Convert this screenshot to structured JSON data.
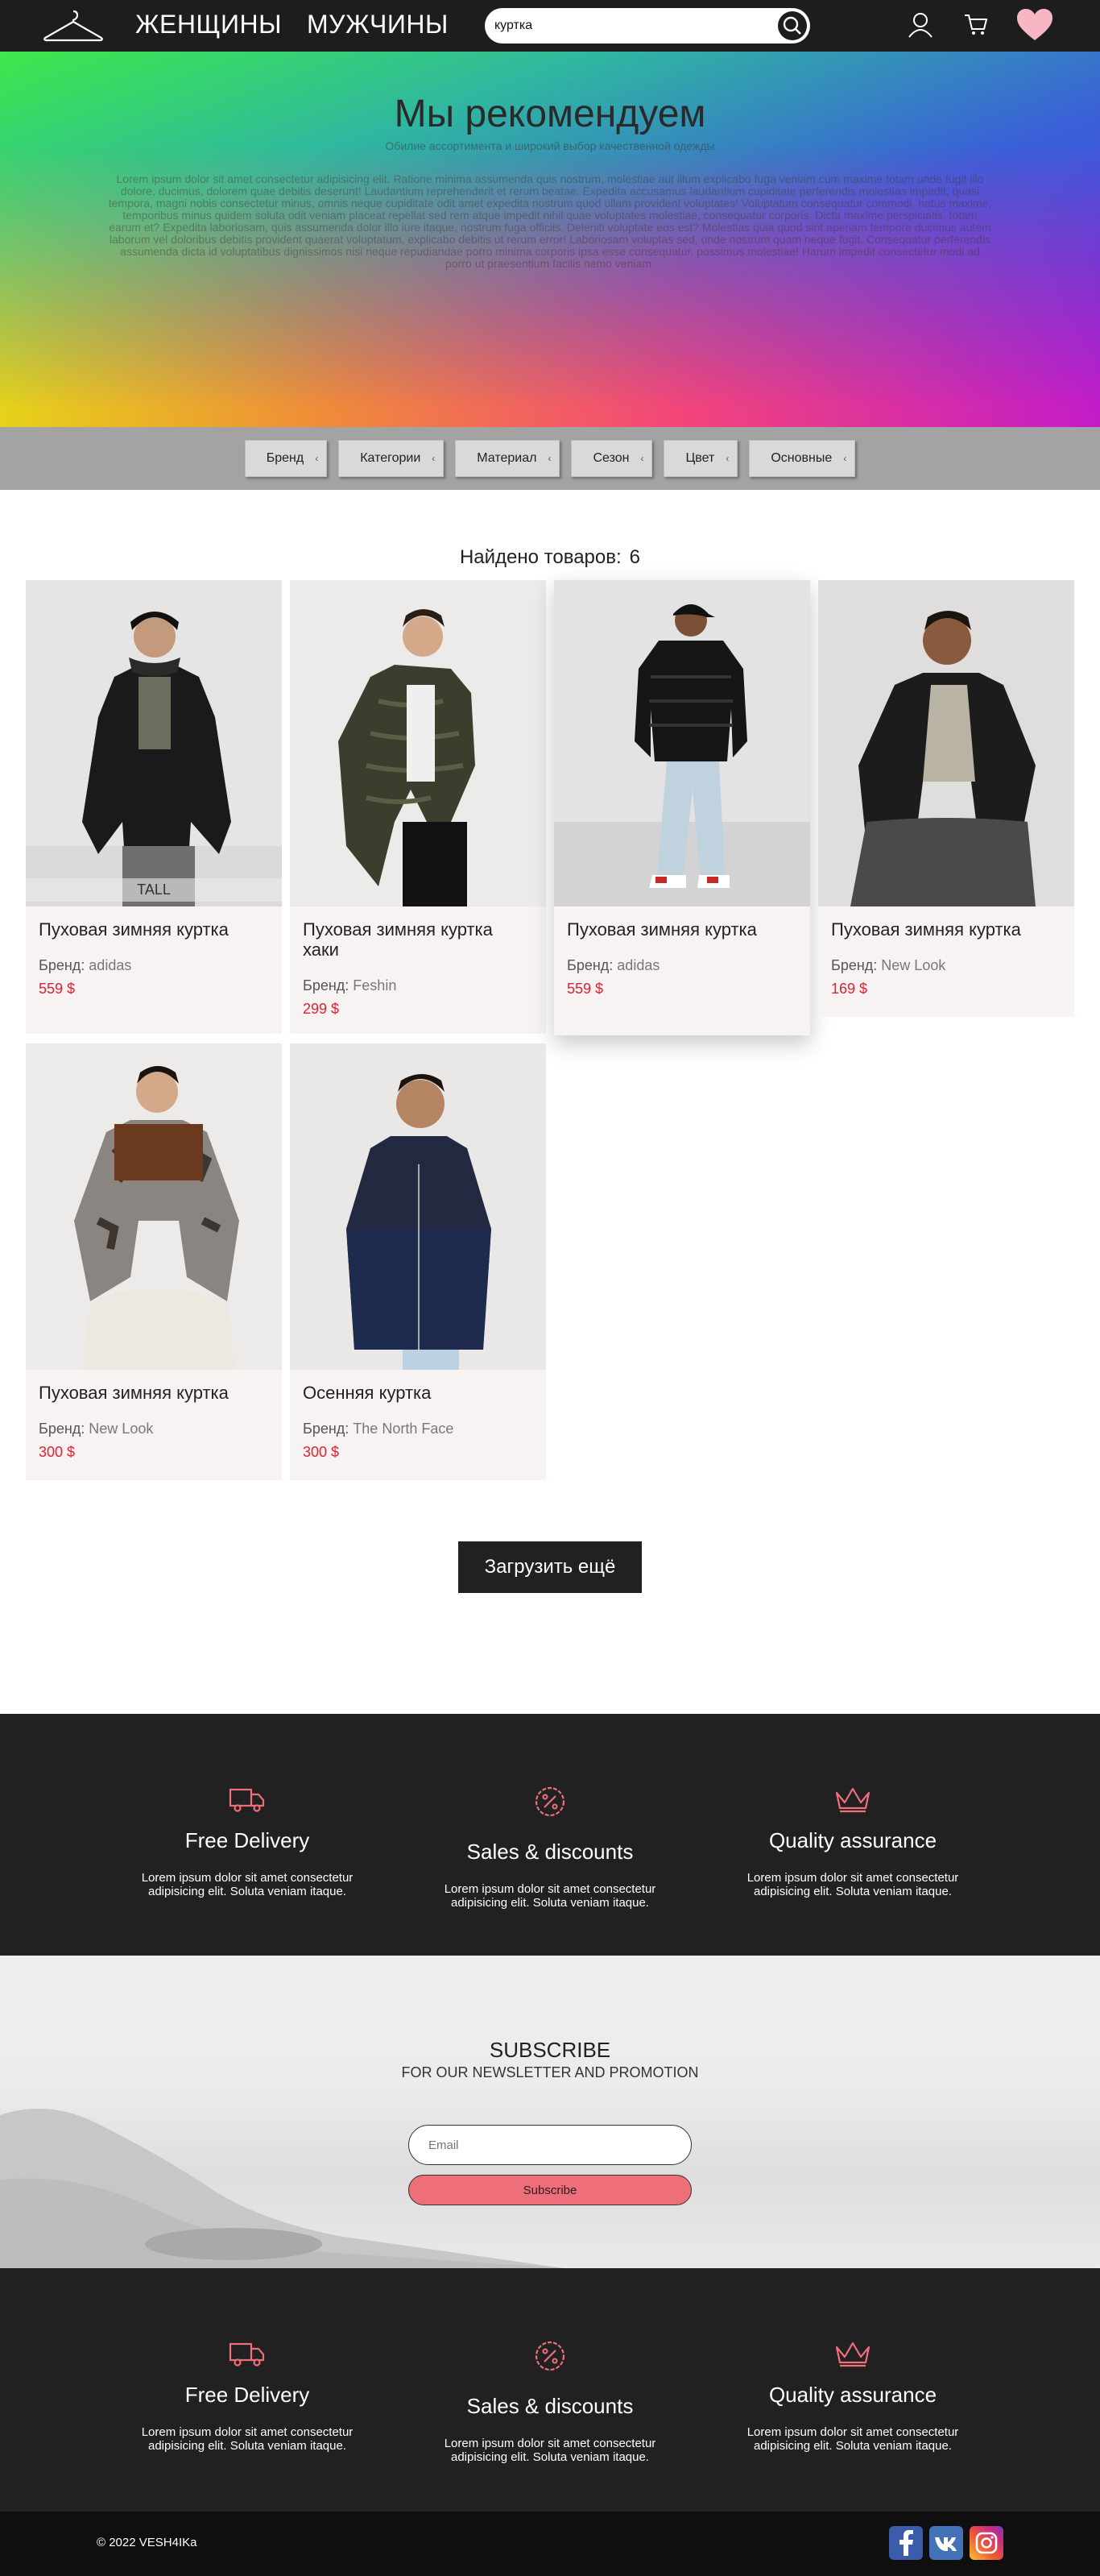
{
  "header": {
    "nav": [
      "ЖЕНЩИНЫ",
      "МУЖЧИНЫ"
    ],
    "search_value": "куртка"
  },
  "hero": {
    "title": "Мы рекомендуем",
    "subtitle": "Обилие ассортимента и широкий выбор качественной одежды",
    "text": "Lorem ipsum dolor sit amet consectetur adipisicing elit. Ratione minima assumenda quis nostrum, molestiae aut illum explicabo fuga veniam cum maxime totam unde fugit illo dolore, ducimus, dolorem quae debitis deserunt! Laudantium reprehenderit et rerum beatae. Expedita accusamus laudantium cupiditate perferendis molestias impedit, quasi tempora, magni nobis consectetur minus, omnis neque cupiditate odit amet expedita nostrum quod ullam provident voluptates! Voluptatum consequatur commodi, natus maxime, temporibus minus quidem soluta odit veniam placeat repellat sed rem atque impedit nihil quae voluptates molestiae, consequatur corporis. Dicta maxime perspiciatis, totam earum et? Expedita laboriosam, quis assumenda dolor illo iure itaque, nostrum fuga officiis. Deleniti voluptate eos est? Molestias quia quod sint aperiam tempore ducimus autem laborum vel doloribus debitis provident quaerat voluptatum, explicabo debitis ut rerum error! Laboriosam voluptas sed, unde nostrum quam neque fugit. Consequatur perferendis assumenda dicta id voluptatibus dignissimos nisi neque repudiandae porro minima corporis ipsa esse consequatur, possimus molestiae! Harum impedit consectetur modi ad porro ut praesentium facilis nemo veniam."
  },
  "filters": [
    "Бренд",
    "Категории",
    "Материал",
    "Сезон",
    "Цвет",
    "Основные"
  ],
  "results": {
    "label": "Найдено товаров:",
    "count": "6"
  },
  "brand_label": "Бренд:",
  "products": [
    {
      "title": "Пуховая зимняя куртка",
      "brand": "adidas",
      "price": "559 $",
      "tag": "TALL"
    },
    {
      "title": "Пуховая зимняя куртка хаки",
      "brand": "Feshin",
      "price": "299 $"
    },
    {
      "title": "Пуховая зимняя куртка",
      "brand": "adidas",
      "price": "559 $"
    },
    {
      "title": "Пуховая зимняя куртка",
      "brand": "New Look",
      "price": "169 $"
    },
    {
      "title": "Пуховая зимняя куртка",
      "brand": "New Look",
      "price": "300 $"
    },
    {
      "title": "Осенняя куртка",
      "brand": "The North Face",
      "price": "300 $"
    }
  ],
  "load_more": "Загрузить ещё",
  "features": [
    {
      "icon": "truck-icon",
      "title": "Free Delivery",
      "text": "Lorem ipsum dolor sit amet consectetur adipisicing elit. Soluta veniam itaque."
    },
    {
      "icon": "percent-badge-icon",
      "title": "Sales & discounts",
      "text": "Lorem ipsum dolor sit amet consectetur adipisicing elit. Soluta veniam itaque."
    },
    {
      "icon": "crown-icon",
      "title": "Quality assurance",
      "text": "Lorem ipsum dolor sit amet consectetur adipisicing elit. Soluta veniam itaque."
    }
  ],
  "subscribe": {
    "title": "SUBSCRIBE",
    "subtitle": "FOR OUR NEWSLETTER AND PROMOTION",
    "email_placeholder": "Email",
    "button": "Subscribe"
  },
  "footer": {
    "copyright": "© 2022 VESH4IKa",
    "social": [
      "facebook-icon",
      "vk-icon",
      "instagram-icon"
    ]
  },
  "colors": {
    "dark": "#212121",
    "price": "#e1212f",
    "accent_pink": "#ee6e7a",
    "heart": "#f7b6c4"
  }
}
